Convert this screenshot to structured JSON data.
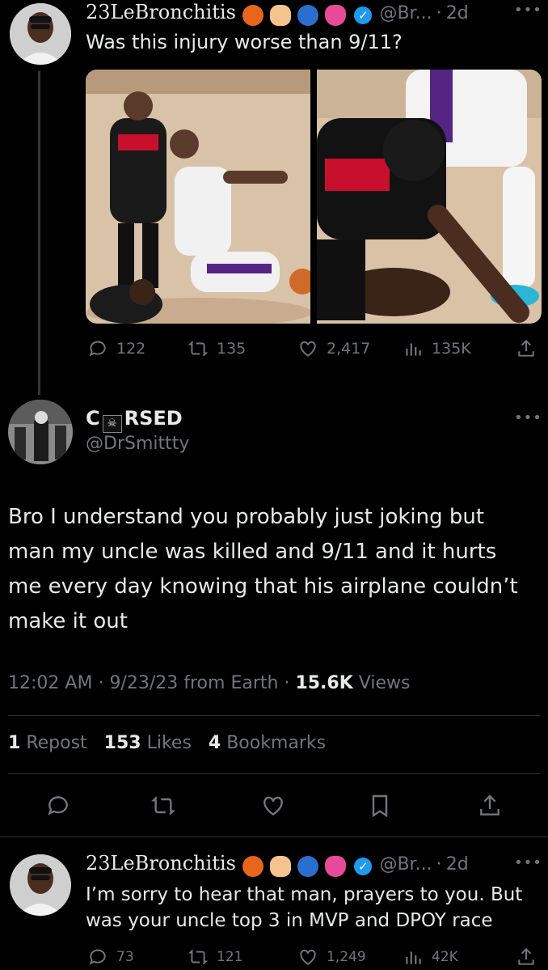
{
  "tweet1": {
    "display_name": "23LeBronchitis",
    "handle": "@Br...",
    "time": "2d",
    "text": "Was this injury worse than 9/11?",
    "stats": {
      "replies": "122",
      "reposts": "135",
      "likes": "2,417",
      "views": "135K"
    }
  },
  "main": {
    "display_name": "C☠RSED",
    "name_prefix": "C",
    "name_suffix": "RSED",
    "handle": "@DrSmittty",
    "text": "Bro I understand you probably just joking but man my uncle was killed and 9/11 and it hurts me every day knowing that his airplane couldn’t make it out",
    "meta": {
      "time": "12:02 AM",
      "date": "9/23/23",
      "source": "from Earth",
      "views_count": "15.6K",
      "views_label": "Views"
    },
    "engagement": {
      "reposts_count": "1",
      "reposts_label": "Repost",
      "likes_count": "153",
      "likes_label": "Likes",
      "bookmarks_count": "4",
      "bookmarks_label": "Bookmarks"
    }
  },
  "tweet2": {
    "display_name": "23LeBronchitis",
    "handle": "@Br...",
    "time": "2d",
    "text": "I’m sorry to hear that man, prayers to you. But was your uncle top 3 in MVP and DPOY race",
    "stats": {
      "replies": "73",
      "reposts": "121",
      "likes": "1,249",
      "views": "42K"
    }
  },
  "separator": "·",
  "colors": {
    "background": "#000000",
    "text": "#e7e9ea",
    "muted": "#71767b",
    "verified": "#1d9bf0",
    "divider": "#2f3336"
  },
  "icons": [
    "reply-icon",
    "repost-icon",
    "like-icon",
    "views-icon",
    "share-icon",
    "bookmark-icon",
    "verified-icon",
    "more-icon",
    "basketball-emoji",
    "globe-emoji",
    "heart-emoji",
    "skull-flag-emoji"
  ]
}
